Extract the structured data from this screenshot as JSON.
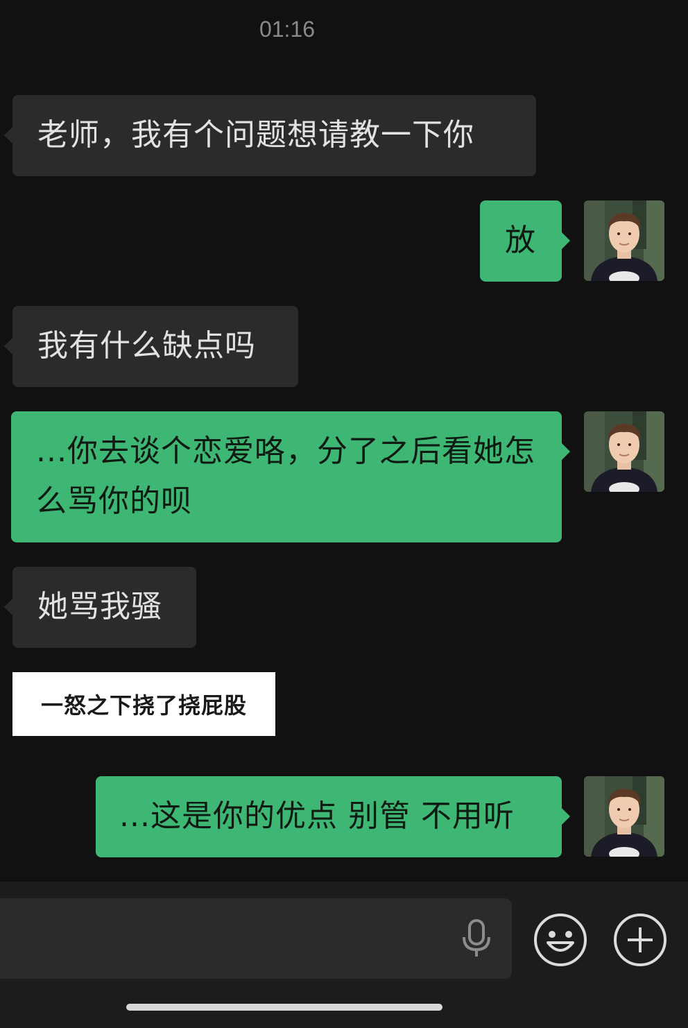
{
  "chat": {
    "timestamp": "01:16",
    "messages": [
      {
        "side": "in",
        "text": "老师，我有个问题想请教一下你"
      },
      {
        "side": "out",
        "text": "放"
      },
      {
        "side": "in",
        "text": "我有什么缺点吗"
      },
      {
        "side": "out",
        "text": "...你去谈个恋爱咯，分了之后看她怎么骂你的呗"
      },
      {
        "side": "in",
        "text": "她骂我骚"
      },
      {
        "side": "in",
        "type": "sticker",
        "text": "一怒之下挠了挠屁股"
      },
      {
        "side": "out",
        "text": "...这是你的优点 别管 不用听"
      }
    ]
  },
  "input_bar": {
    "icons": [
      "microphone-icon",
      "emoji-icon",
      "plus-icon"
    ]
  },
  "colors": {
    "background": "#111111",
    "incoming_bubble": "#2b2b2b",
    "outgoing_bubble": "#3fb774",
    "sticker_background": "#ffffff"
  }
}
